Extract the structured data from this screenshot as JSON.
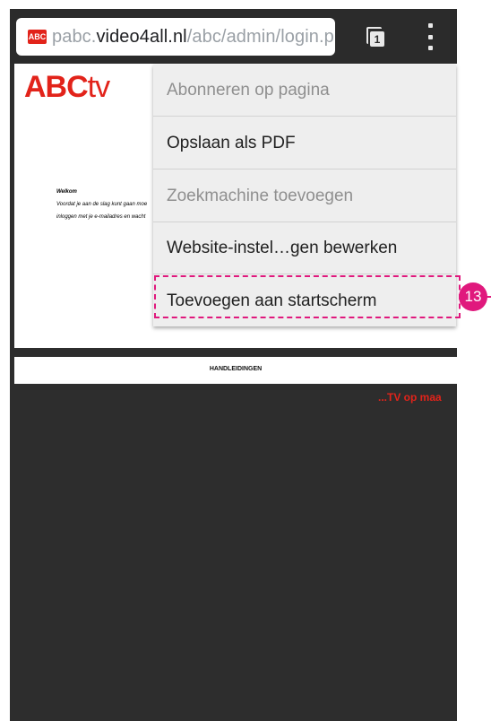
{
  "browser": {
    "favicon_text": "ABC",
    "url_prefix": "pabc.",
    "url_domain": "video4all.nl",
    "url_path": "/abc/admin/login.p",
    "tab_count": "1"
  },
  "page": {
    "logo_abc": "ABC",
    "logo_tv": "tv",
    "welcome_heading": "Welkom",
    "welcome_line1": "Voordat je aan de slag kunt gaan moe",
    "welcome_line2": "inloggen met je e-mailadres en wacht",
    "handleidingen": "HANDLEIDINGEN",
    "tagline": "...TV op maa"
  },
  "menu": {
    "items": [
      {
        "label": "Abonneren op pagina",
        "disabled": true
      },
      {
        "label": "Opslaan als PDF",
        "disabled": false
      },
      {
        "label": "Zoekmachine toevoegen",
        "disabled": true
      },
      {
        "label": "Website-instel…gen bewerken",
        "disabled": false
      },
      {
        "label": "Toevoegen aan startscherm",
        "disabled": false
      }
    ]
  },
  "annotation": {
    "step_number": "13",
    "color": "#e0197d"
  },
  "colors": {
    "brand_red": "#e2231a",
    "toolbar_bg": "#2b2b2b",
    "menu_bg": "#eeeeee"
  }
}
